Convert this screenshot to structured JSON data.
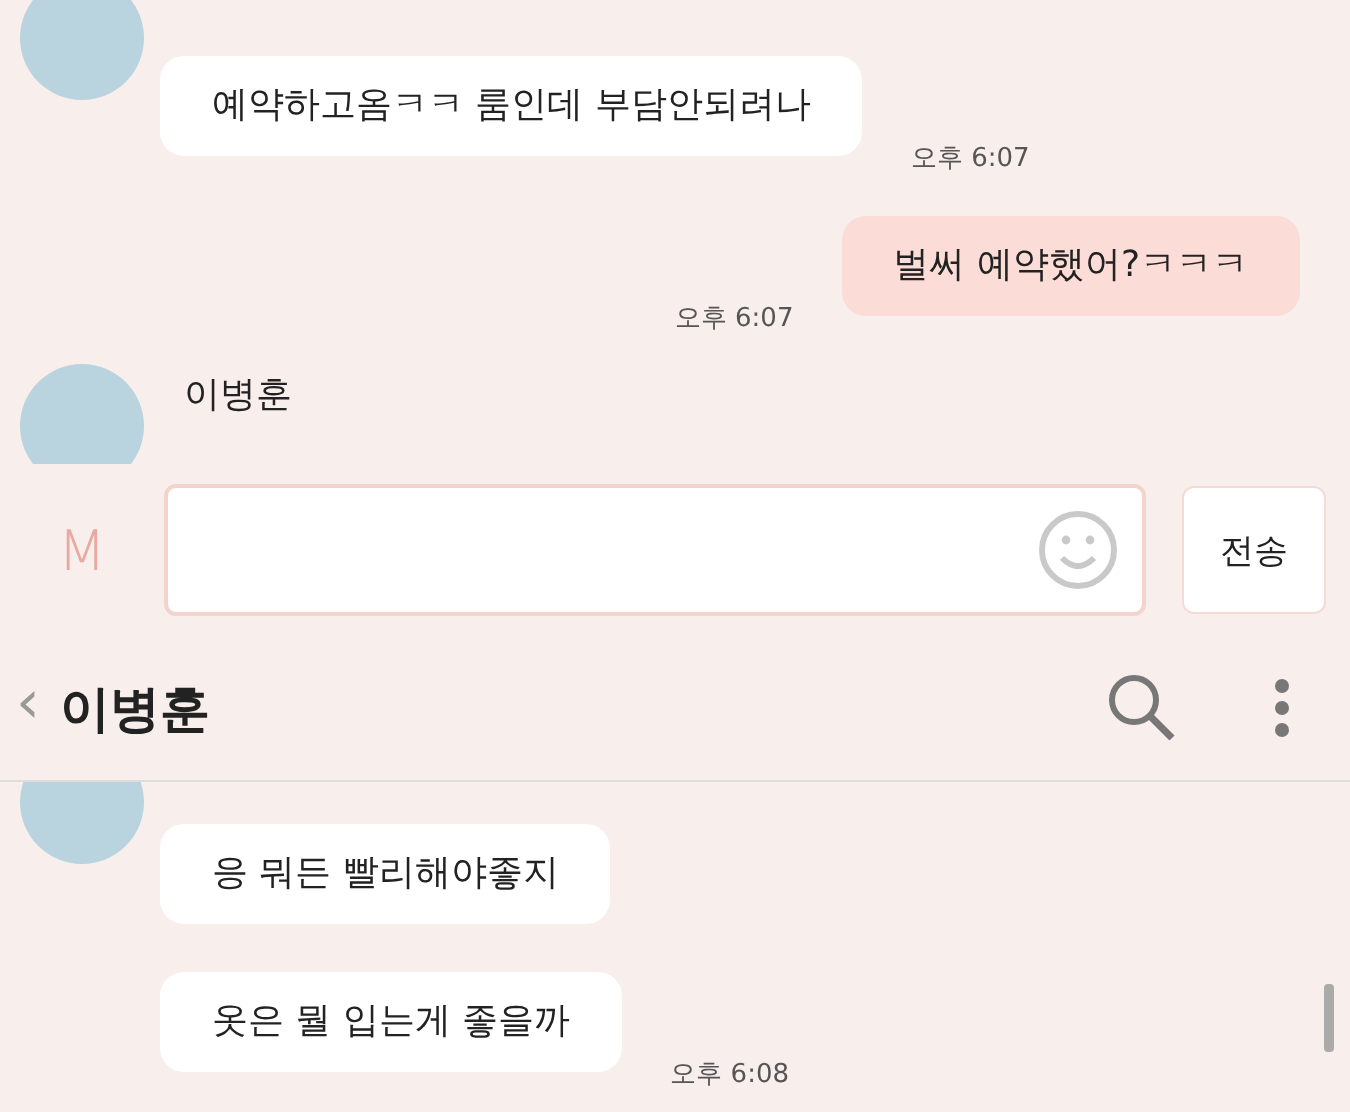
{
  "screens": [
    {
      "messages": [
        {
          "kind": "incoming",
          "bubbles": [
            {
              "text": "예약하고옴ㅋㅋ 룸인데 부담안되려나",
              "time": "오후 6:07"
            }
          ]
        },
        {
          "kind": "outgoing",
          "bubbles": [
            {
              "text": "벌써 예약했어?ㅋㅋㅋ",
              "time": "오후 6:07"
            }
          ]
        },
        {
          "kind": "incoming",
          "name": "이병훈"
        }
      ],
      "composer": {
        "icon_letter": "M",
        "send": "전송"
      }
    },
    {
      "header": {
        "back": "‹",
        "title": "이병훈"
      },
      "messages": [
        {
          "kind": "incoming",
          "bubbles": [
            {
              "text": "응 뭐든 빨리해야좋지"
            },
            {
              "text": "옷은 뭘 입는게 좋을까",
              "time": "오후 6:08"
            }
          ]
        }
      ]
    }
  ]
}
